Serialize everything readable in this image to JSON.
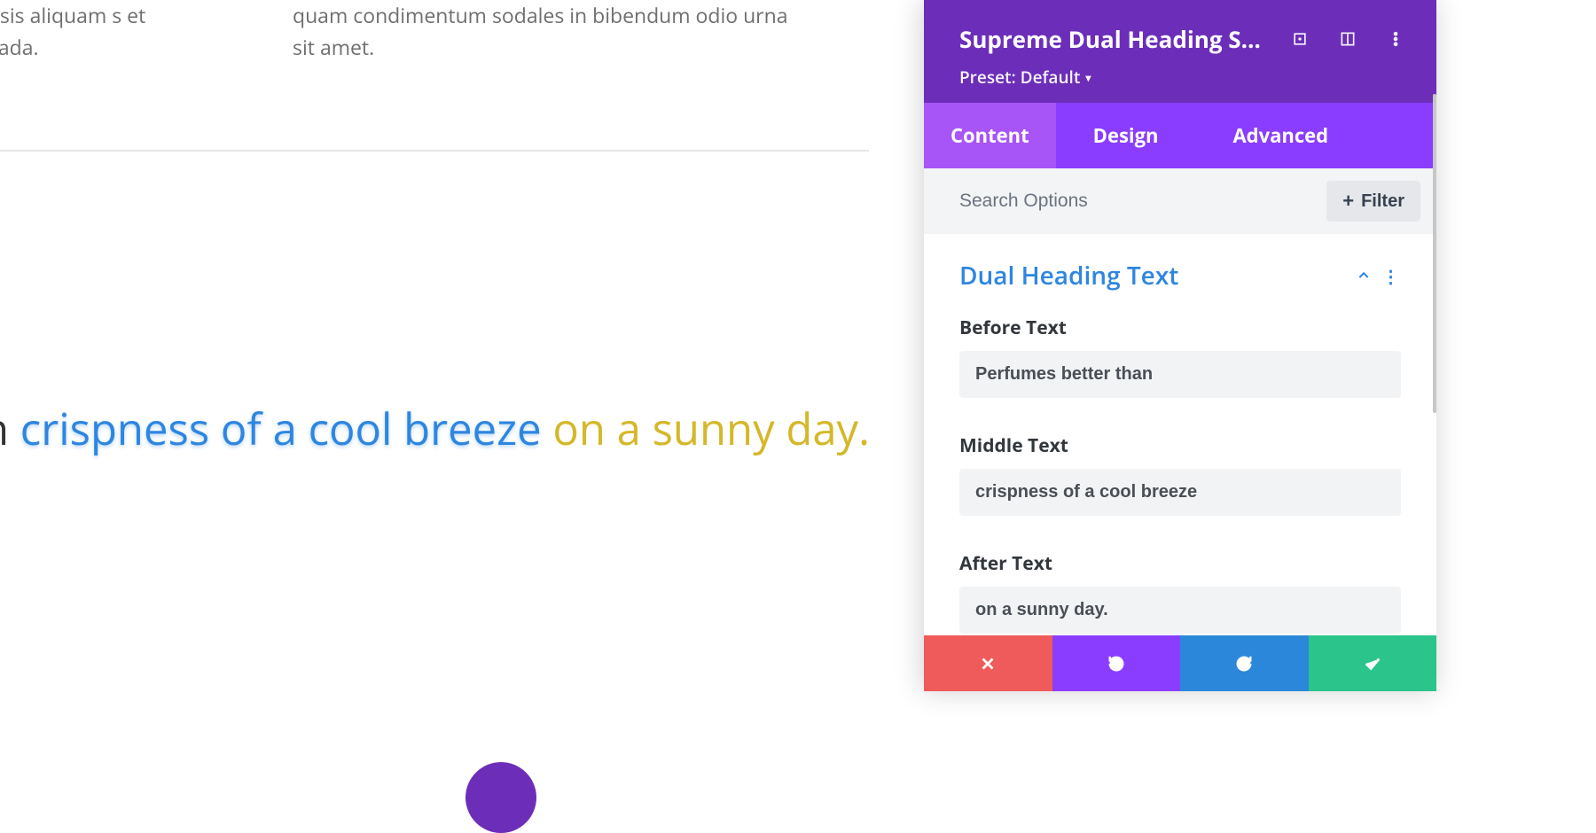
{
  "canvas": {
    "lorem_left": "tis facilisis aliquam s et malesuada.",
    "lorem_right": "quam condimentum sodales in bibendum odio urna sit amet.",
    "heading_before": "tter than",
    "heading_middle": "crispness of a cool breeze",
    "heading_after": "on a sunny day."
  },
  "panel": {
    "title": "Supreme Dual Heading Set...",
    "preset_label": "Preset: Default",
    "tabs": {
      "content": "Content",
      "design": "Design",
      "advanced": "Advanced"
    },
    "search_placeholder": "Search Options",
    "filter_label": "Filter",
    "section_title": "Dual Heading Text",
    "fields": {
      "before_label": "Before Text",
      "before_value": "Perfumes better than",
      "middle_label": "Middle Text",
      "middle_value": "crispness of a cool breeze",
      "after_label": "After Text",
      "after_value": "on a sunny day."
    }
  }
}
